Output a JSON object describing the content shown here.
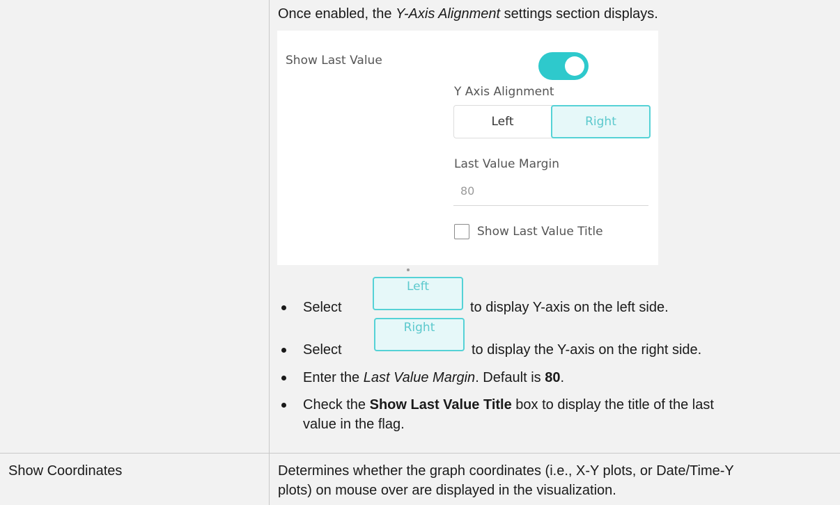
{
  "intro": {
    "pre": "Once enabled, the ",
    "em": "Y-Axis Alignment",
    "post": " settings section displays."
  },
  "panel": {
    "show_last_value_label": "Show Last Value",
    "toggle_state": "on",
    "y_axis_alignment_label": "Y Axis Alignment",
    "alignment_options": [
      "Left",
      "Right"
    ],
    "alignment_selected": "Right",
    "last_value_margin_label": "Last Value Margin",
    "last_value_margin_value": "80",
    "show_last_value_title_label": "Show Last Value Title",
    "show_last_value_title_checked": false
  },
  "bullets": {
    "b1_pre": "Select",
    "b1_button": "Left",
    "b1_post": "to display Y-axis on the left side.",
    "b2_pre": "Select",
    "b2_button": "Right",
    "b2_post": "to display the Y-axis on the right side.",
    "b3_pre": "Enter the ",
    "b3_em": "Last Value Margin",
    "b3_mid": ". Default is ",
    "b3_bold": "80",
    "b3_post": ".",
    "b4_pre": "Check the ",
    "b4_bold": "Show Last Value Title",
    "b4_line1_post": " box to display the title of the last",
    "b4_line2": "value in the flag."
  },
  "row2": {
    "property": "Show Coordinates",
    "description_line1": "Determines whether the graph coordinates (i.e., X-Y plots, or Date/Time-Y",
    "description_line2": "plots) on mouse over are displayed in the visualization."
  },
  "colors": {
    "accent": "#2ec9cc",
    "cell_background": "#f2f2f2"
  }
}
